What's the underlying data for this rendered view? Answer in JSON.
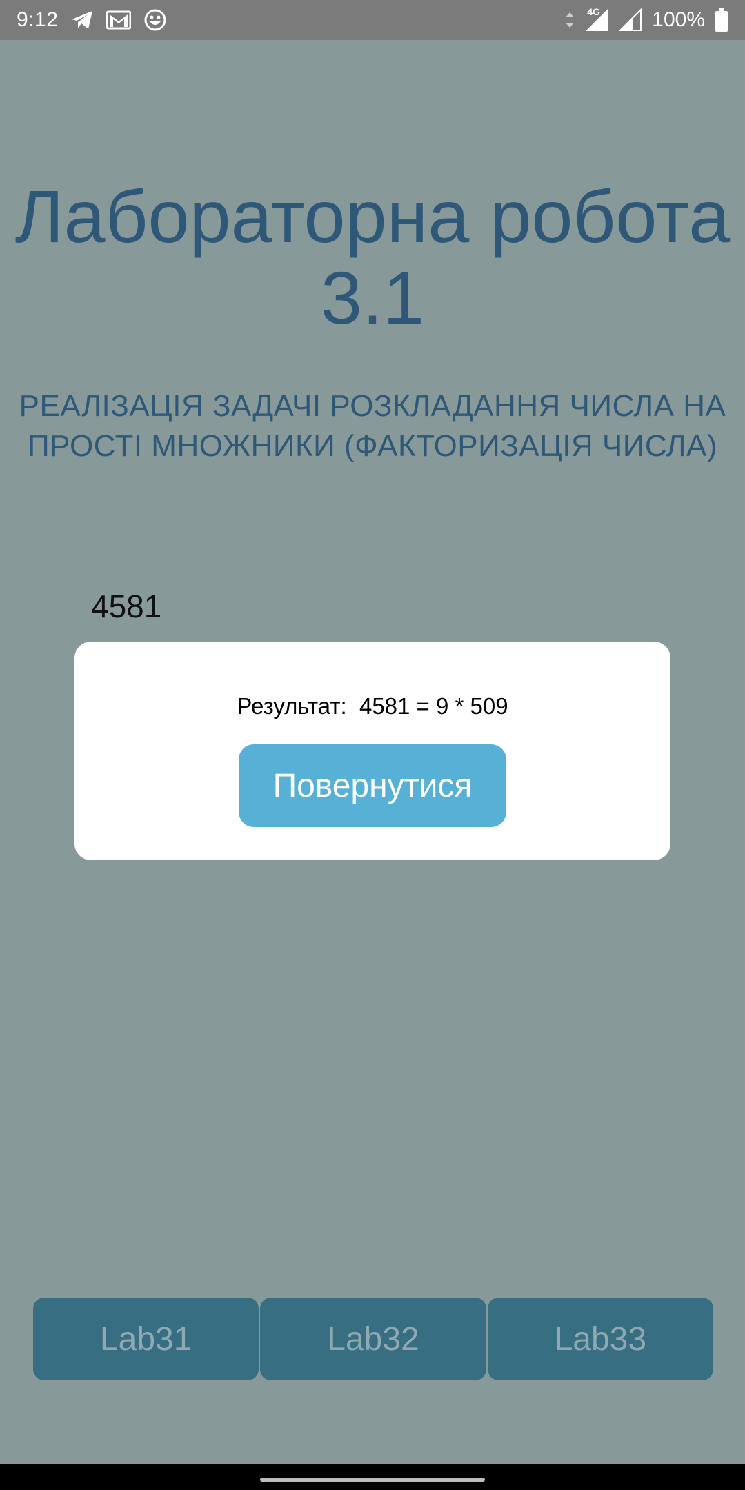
{
  "status_bar": {
    "time": "9:12",
    "left_icons": [
      "telegram-icon",
      "gmail-icon",
      "emoji-icon"
    ],
    "right_icons": [
      "data-arrows-icon",
      "signal-4g-icon",
      "signal-icon",
      "battery-icon"
    ],
    "network_label": "4G",
    "battery": "100%"
  },
  "page": {
    "title": "Лабораторна робота 3.1",
    "subtitle": "РЕАЛІЗАЦІЯ ЗАДАЧІ РОЗКЛАДАННЯ ЧИСЛА НА ПРОСТІ МНОЖНИКИ (ФАКТОРИЗАЦІЯ ЧИСЛА)",
    "input_value": "4581"
  },
  "modal": {
    "result_text": "Результат:  4581 = 9 * 509",
    "back_label": "Повернутися"
  },
  "tabs": [
    {
      "label": "Lab31"
    },
    {
      "label": "Lab32"
    },
    {
      "label": "Lab33"
    }
  ],
  "colors": {
    "background": "#879999",
    "title": "#2f5878",
    "button": "#57b1d7",
    "tab": "#376e82"
  }
}
